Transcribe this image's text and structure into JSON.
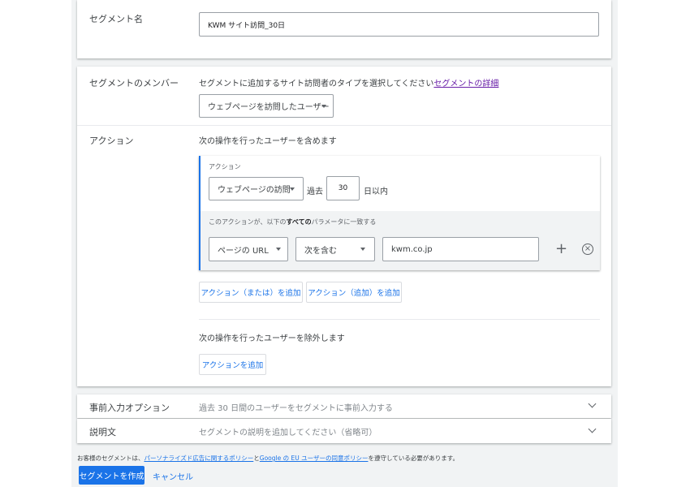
{
  "segment_name": {
    "label": "セグメント名",
    "value": "KWM サイト訪問_30日"
  },
  "members": {
    "label": "セグメントのメンバー",
    "description": "セグメントに追加するサイト訪問者のタイプを選択してください",
    "details_link": "セグメントの詳細",
    "type_select": "ウェブページを訪問したユーザー"
  },
  "action": {
    "label": "アクション",
    "include_text": "次の操作を行ったユーザーを含めます",
    "box_title": "アクション",
    "action_select": "ウェブページの訪問",
    "past_label": "過去",
    "days_value": "30",
    "days_suffix": "日以内",
    "param_note_pre": "このアクションが、以下の",
    "param_note_bold": "すべての",
    "param_note_post": "パラメータに一致する",
    "param_field": "ページの URL",
    "param_operator": "次を含む",
    "param_value": "kwm.co.jp",
    "add_or_button": "アクション（または）を追加",
    "add_and_button": "アクション（追加）を追加",
    "exclude_text": "次の操作を行ったユーザーを除外します",
    "add_action_button": "アクションを追加"
  },
  "prefill": {
    "label": "事前入力オプション",
    "summary": "過去 30 日間のユーザーをセグメントに事前入力する"
  },
  "description": {
    "label": "説明文",
    "summary": "セグメントの説明を追加してください（省略可）"
  },
  "footer": {
    "policy_pre": "お客様のセグメントは、",
    "policy_link1": "パーソナライズド広告に関するポリシー",
    "policy_mid": "と",
    "policy_link2": "Google の EU ユーザーの同意ポリシー",
    "policy_post": "を遵守している必要があります。",
    "create_button": "セグメントを作成",
    "cancel_button": "キャンセル"
  },
  "colors": {
    "primary": "#1a73e8",
    "link_visited": "#681da8"
  },
  "icons": {
    "add": "plus-icon",
    "remove": "circle-x-icon",
    "expand": "chevron-down-icon"
  }
}
